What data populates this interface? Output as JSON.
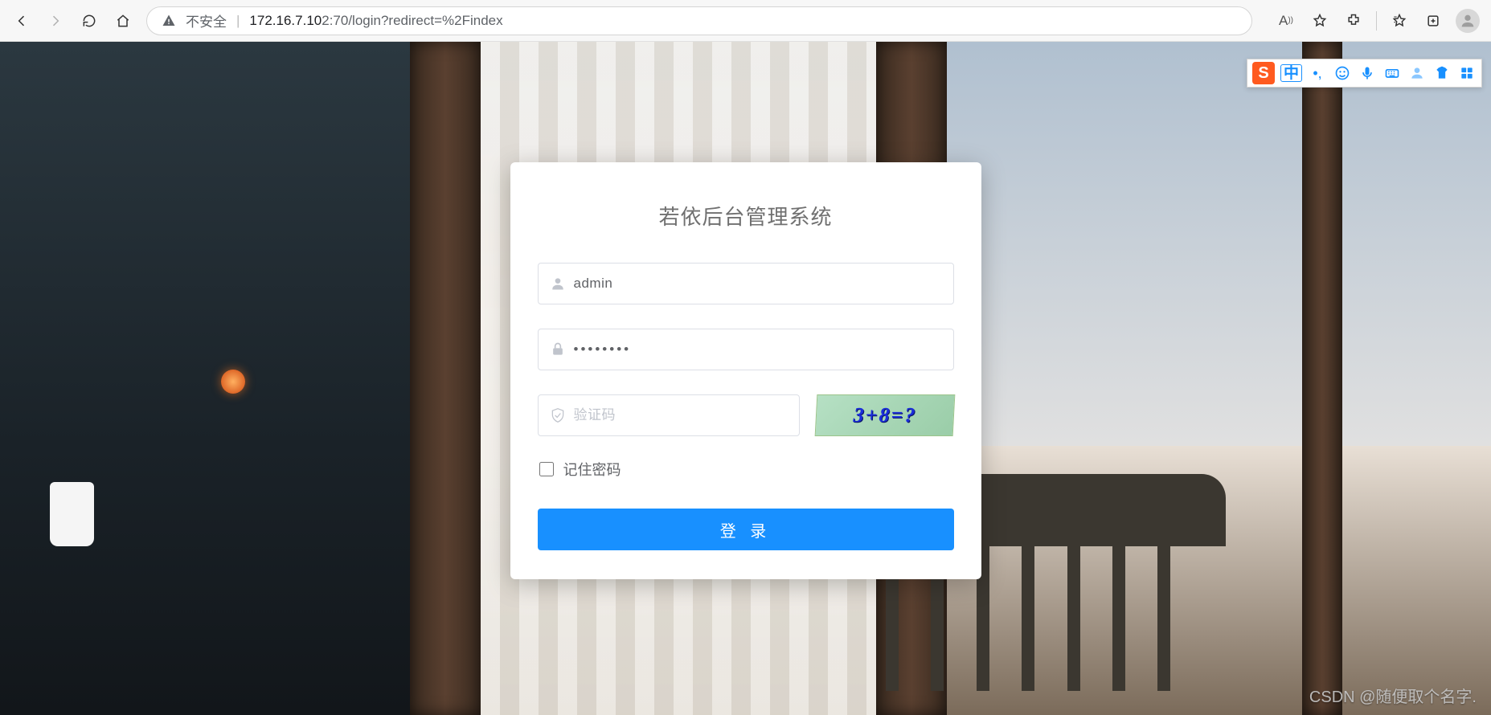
{
  "browser": {
    "insecure_label": "不安全",
    "url_prefix": "172.16.7.10",
    "url_port": "2:70",
    "url_path": "/login?redirect=%2Findex",
    "read_aloud_label": "A"
  },
  "login": {
    "title": "若依后台管理系统",
    "username_value": "admin",
    "password_value": "••••••••",
    "captcha_placeholder": "验证码",
    "captcha_text": "3+8=?",
    "remember_label": "记住密码",
    "submit_label": "登 录"
  },
  "ime": {
    "logo": "S",
    "lang": "中"
  },
  "watermark": "CSDN @随便取个名字."
}
